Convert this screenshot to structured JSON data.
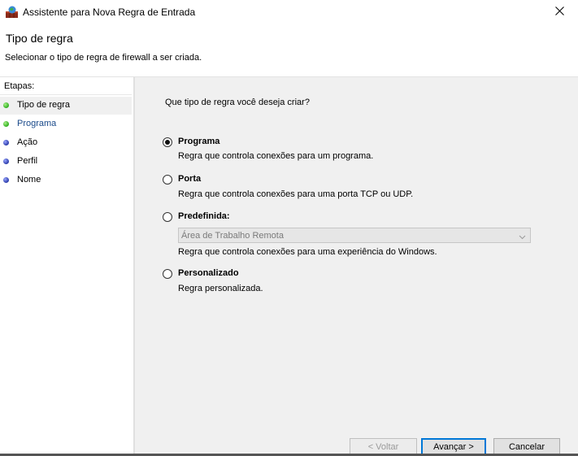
{
  "window": {
    "title": "Assistente para Nova Regra de Entrada",
    "close_icon": "close-icon",
    "app_icon": "firewall-icon"
  },
  "header": {
    "title": "Tipo de regra",
    "subtitle": "Selecionar o tipo de regra de firewall a ser criada."
  },
  "sidebar": {
    "header": "Etapas:",
    "steps": [
      {
        "label": "Tipo de regra",
        "status": "done"
      },
      {
        "label": "Programa",
        "status": "current"
      },
      {
        "label": "Ação",
        "status": "pending"
      },
      {
        "label": "Perfil",
        "status": "pending"
      },
      {
        "label": "Nome",
        "status": "pending"
      }
    ]
  },
  "main": {
    "question": "Que tipo de regra você deseja criar?",
    "options": [
      {
        "label": "Programa",
        "description": "Regra que controla conexões para um programa.",
        "selected": true
      },
      {
        "label": "Porta",
        "description": "Regra que controla conexões para uma porta TCP ou UDP.",
        "selected": false
      },
      {
        "label": "Predefinida:",
        "description": "Regra que controla conexões para uma experiência do Windows.",
        "selected": false
      },
      {
        "label": "Personalizado",
        "description": "Regra personalizada.",
        "selected": false
      }
    ],
    "predefined_dropdown": {
      "value": "Área de Trabalho Remota",
      "enabled": false
    }
  },
  "buttons": {
    "back": "< Voltar",
    "next": "Avançar >",
    "cancel": "Cancelar"
  },
  "colors": {
    "accent": "#0078d7",
    "step_done": "#2fae1e",
    "step_pending": "#2a3aa8"
  }
}
